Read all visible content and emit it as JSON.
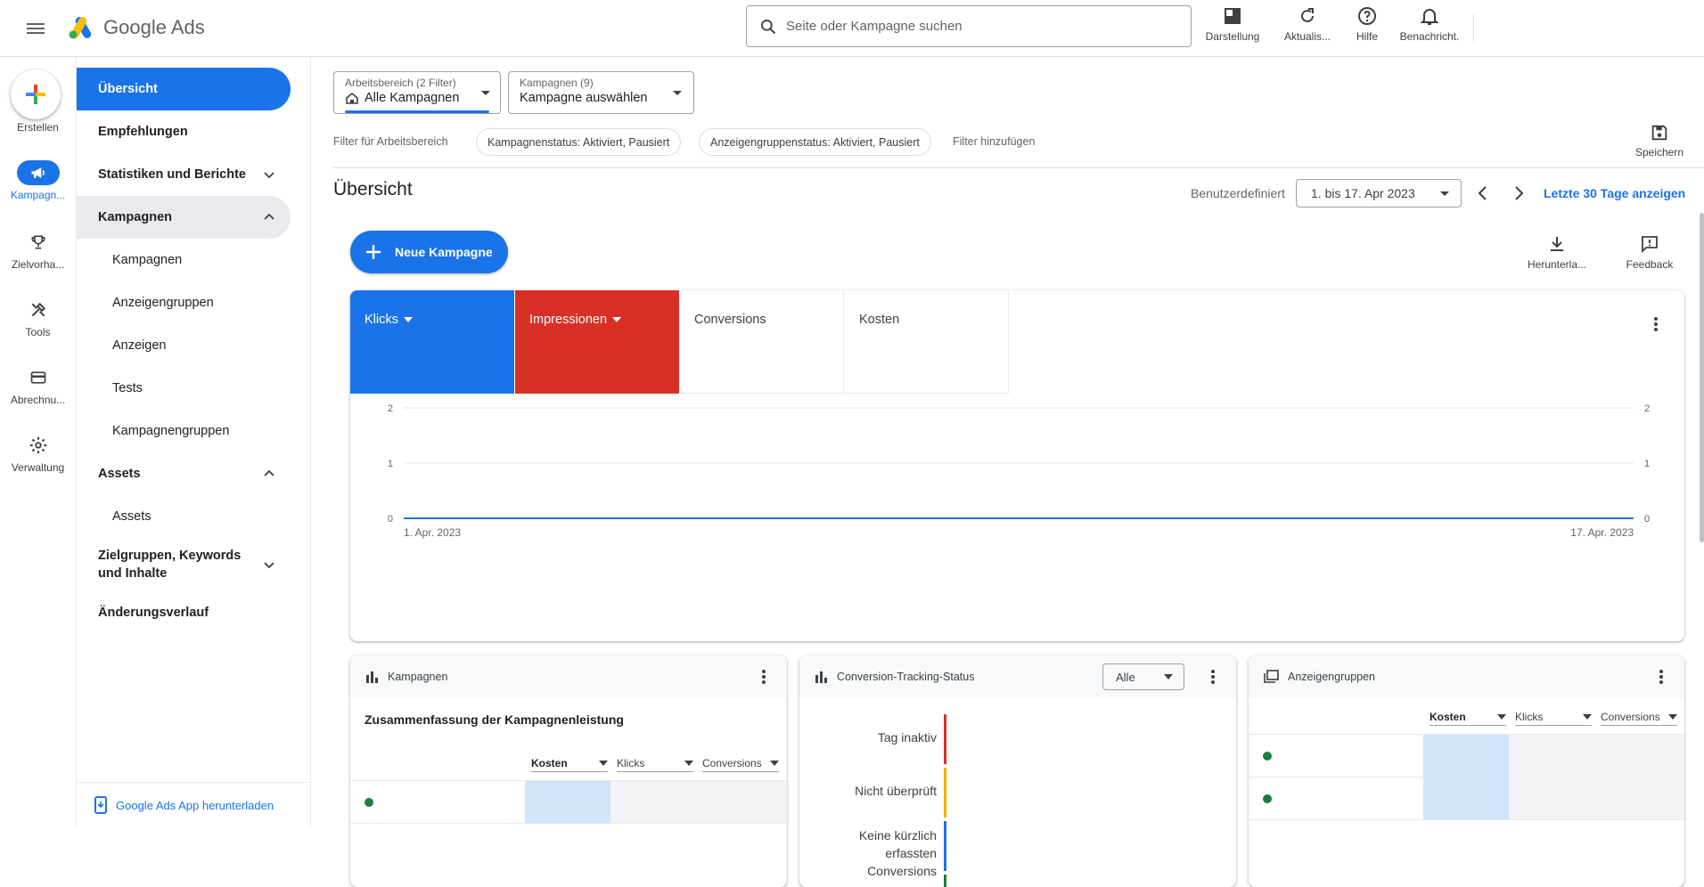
{
  "header": {
    "app_name": "Google Ads",
    "search_placeholder": "Seite oder Kampagne suchen",
    "buttons": {
      "appearance": "Darstellung",
      "refresh": "Aktualis...",
      "help": "Hilfe",
      "notifications": "Benachricht."
    }
  },
  "rail": {
    "create": "Erstellen",
    "campaigns": "Kampagn...",
    "goals": "Zielvorha...",
    "tools": "Tools",
    "billing": "Abrechnu...",
    "admin": "Verwaltung"
  },
  "nav": {
    "overview": "Übersicht",
    "recommendations": "Empfehlungen",
    "insights": "Statistiken und Berichte",
    "campaigns_group": "Kampagnen",
    "campaigns": "Kampagnen",
    "adgroups": "Anzeigengruppen",
    "ads": "Anzeigen",
    "tests": "Tests",
    "campaign_groups": "Kampagnengruppen",
    "assets_group": "Assets",
    "assets": "Assets",
    "audiences": "Zielgruppen, Keywords und Inhalte",
    "change_history": "Änderungsverlauf",
    "download_app": "Google Ads App herunterladen"
  },
  "filters": {
    "workspace_label": "Arbeitsbereich (2 Filter)",
    "workspace_value": "Alle Kampagnen",
    "campaigns_label": "Kampagnen (9)",
    "campaigns_value": "Kampagne auswählen",
    "workspace_filter_label": "Filter für Arbeitsbereich",
    "chip_campaign_status": "Kampagnenstatus: Aktiviert, Pausiert",
    "chip_adgroup_status": "Anzeigengruppenstatus: Aktiviert, Pausiert",
    "add_filter": "Filter hinzufügen",
    "save": "Speichern"
  },
  "page": {
    "title": "Übersicht",
    "date_label": "Benutzerdefiniert",
    "date_range": "1. bis 17. Apr 2023",
    "last_30_days": "Letzte 30 Tage anzeigen",
    "new_campaign": "Neue Kampagne",
    "download": "Herunterla...",
    "feedback": "Feedback"
  },
  "colors": {
    "blue": "#1a73e8",
    "red": "#d93025",
    "green": "#188038",
    "yellow": "#f9ab00"
  },
  "chart_data": {
    "type": "line",
    "metrics": [
      "Klicks",
      "Impressionen",
      "Conversions",
      "Kosten"
    ],
    "x_tick_labels": [
      "1. Apr. 2023",
      "17. Apr. 2023"
    ],
    "y_ticks": [
      0,
      1,
      2
    ],
    "ylim": [
      0,
      2
    ],
    "grid": true,
    "series": [
      {
        "name": "Klicks",
        "color": "#1a73e8",
        "values": [
          0,
          0,
          0,
          0,
          0,
          0,
          0,
          0,
          0,
          0,
          0,
          0,
          0,
          0,
          0,
          0,
          0
        ]
      },
      {
        "name": "Impressionen",
        "color": "#d93025",
        "values": [
          0,
          0,
          0,
          0,
          0,
          0,
          0,
          0,
          0,
          0,
          0,
          0,
          0,
          0,
          0,
          0,
          0
        ]
      }
    ]
  },
  "cards": {
    "campaigns": {
      "title": "Kampagnen",
      "subtitle": "Zusammenfassung der Kampagnenleistung",
      "columns": [
        "Kosten",
        "Klicks",
        "Conversions"
      ]
    },
    "conversion": {
      "title": "Conversion-Tracking-Status",
      "dropdown": "Alle",
      "labels": [
        "Tag inaktiv",
        "Nicht überprüft",
        "Keine kürzlich erfassten Conversions"
      ]
    },
    "adgroups": {
      "title": "Anzeigengruppen",
      "columns": [
        "Kosten",
        "Klicks",
        "Conversions"
      ]
    }
  }
}
